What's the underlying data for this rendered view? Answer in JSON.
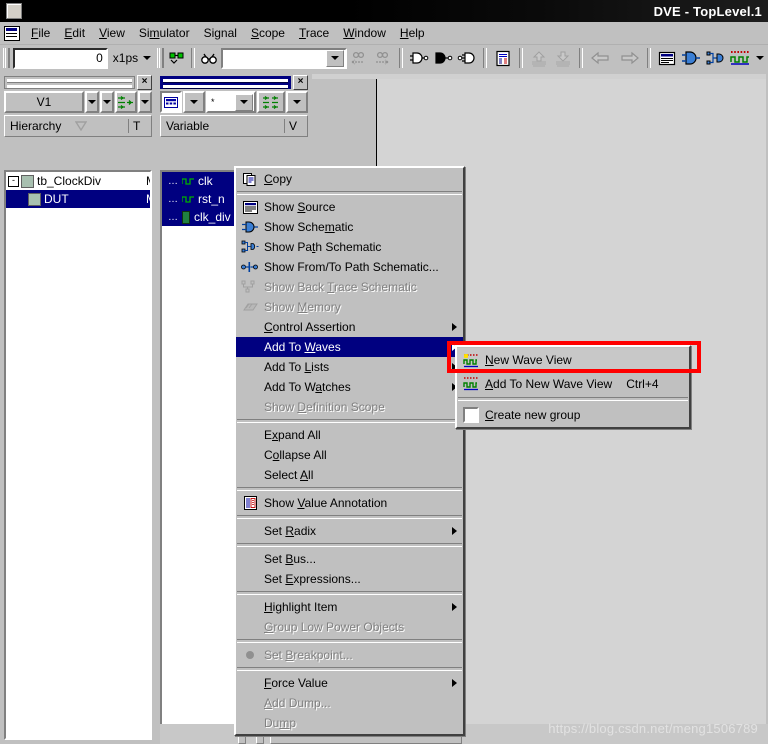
{
  "window": {
    "title": "DVE - TopLevel.1",
    "icon": "window-icon"
  },
  "menubar": {
    "icon": "document-menu-icon",
    "items": [
      {
        "label": "File",
        "mnemonic": "F"
      },
      {
        "label": "Edit",
        "mnemonic": "E"
      },
      {
        "label": "View",
        "mnemonic": "V"
      },
      {
        "label": "Simulator",
        "mnemonic": "m"
      },
      {
        "label": "Signal",
        "mnemonic": "S"
      },
      {
        "label": "Scope",
        "mnemonic": "S"
      },
      {
        "label": "Trace",
        "mnemonic": "T"
      },
      {
        "label": "Window",
        "mnemonic": "W"
      },
      {
        "label": "Help",
        "mnemonic": "H"
      }
    ]
  },
  "toolbar": {
    "time_value": "0",
    "time_unit": "x1ps",
    "goto_icon": "goto-signal-icon",
    "find_icon": "binoculars-find-icon",
    "search_value": "",
    "search_placeholder": "",
    "buttons": [
      {
        "name": "find-prev-icon"
      },
      {
        "name": "find-next-icon"
      },
      {
        "name": "show-driver-icon"
      },
      {
        "name": "show-load-icon"
      },
      {
        "name": "show-fanout-icon"
      },
      {
        "name": "show-source-icon"
      },
      {
        "name": "raise-icon"
      },
      {
        "name": "lower-icon"
      },
      {
        "name": "back-icon"
      },
      {
        "name": "forward-icon"
      },
      {
        "name": "source-view-icon"
      },
      {
        "name": "schematic-view-icon"
      },
      {
        "name": "path-schematic-icon"
      },
      {
        "name": "wave-view-icon"
      },
      {
        "name": "wave-dropdown-icon"
      }
    ]
  },
  "hierarchy_panel": {
    "title_active": false,
    "close_label": "×",
    "scope_combo": "V1",
    "column_headers": [
      "Hierarchy",
      "T"
    ],
    "sort_icon": "sort-descending-icon",
    "rows": [
      {
        "label": "tb_ClockDiv",
        "type": "M",
        "indent": 0,
        "selected": false,
        "expander": "-"
      },
      {
        "label": "DUT",
        "type": "M",
        "indent": 1,
        "selected": true,
        "expander": ""
      }
    ]
  },
  "variable_panel": {
    "title_active": true,
    "close_label": "×",
    "filter_value": "*",
    "column_headers": [
      "Variable",
      "V"
    ],
    "rows": [
      {
        "label": "clk",
        "icon": "wave-signal-icon",
        "selected": true
      },
      {
        "label": "rst_n",
        "icon": "wave-signal-icon",
        "selected": true
      },
      {
        "label": "clk_div",
        "icon": "bus-signal-icon",
        "selected": true
      }
    ]
  },
  "context_menu": {
    "groups": [
      [
        {
          "label": "Copy",
          "mnemonic": "C",
          "icon": "copy-icon",
          "enabled": true,
          "submenu": false,
          "highlighted": false,
          "accel": ""
        }
      ],
      [
        {
          "label": "Show Source",
          "mnemonic": "S",
          "icon": "source-icon",
          "enabled": true,
          "submenu": false,
          "highlighted": false,
          "accel": ""
        },
        {
          "label": "Show Schematic",
          "mnemonic": "m",
          "icon": "schematic-icon",
          "enabled": true,
          "submenu": false,
          "highlighted": false,
          "accel": ""
        },
        {
          "label": "Show Path Schematic",
          "mnemonic": "t",
          "icon": "path-schematic-icon",
          "enabled": true,
          "submenu": false,
          "highlighted": false,
          "accel": ""
        },
        {
          "label": "Show From/To Path Schematic...",
          "mnemonic": "",
          "icon": "from-to-path-icon",
          "enabled": true,
          "submenu": false,
          "highlighted": false,
          "accel": ""
        },
        {
          "label": "Show Back Trace Schematic",
          "mnemonic": "T",
          "icon": "back-trace-icon",
          "enabled": false,
          "submenu": false,
          "highlighted": false,
          "accel": ""
        },
        {
          "label": "Show Memory",
          "mnemonic": "M",
          "icon": "memory-icon",
          "enabled": false,
          "submenu": false,
          "highlighted": false,
          "accel": ""
        },
        {
          "label": "Control Assertion",
          "mnemonic": "C",
          "icon": "",
          "enabled": true,
          "submenu": true,
          "highlighted": false,
          "accel": ""
        },
        {
          "label": "Add To Waves",
          "mnemonic": "W",
          "icon": "",
          "enabled": true,
          "submenu": true,
          "highlighted": true,
          "accel": ""
        },
        {
          "label": "Add To Lists",
          "mnemonic": "L",
          "icon": "",
          "enabled": true,
          "submenu": true,
          "highlighted": false,
          "accel": ""
        },
        {
          "label": "Add To Watches",
          "mnemonic": "a",
          "icon": "",
          "enabled": true,
          "submenu": true,
          "highlighted": false,
          "accel": ""
        },
        {
          "label": "Show Definition Scope",
          "mnemonic": "D",
          "icon": "",
          "enabled": false,
          "submenu": false,
          "highlighted": false,
          "accel": ""
        }
      ],
      [
        {
          "label": "Expand All",
          "mnemonic": "x",
          "icon": "",
          "enabled": true,
          "submenu": false,
          "highlighted": false,
          "accel": ""
        },
        {
          "label": "Collapse All",
          "mnemonic": "o",
          "icon": "",
          "enabled": true,
          "submenu": false,
          "highlighted": false,
          "accel": ""
        },
        {
          "label": "Select All",
          "mnemonic": "A",
          "icon": "",
          "enabled": true,
          "submenu": false,
          "highlighted": false,
          "accel": ""
        }
      ],
      [
        {
          "label": "Show Value Annotation",
          "mnemonic": "V",
          "icon": "annotation-icon",
          "enabled": true,
          "submenu": false,
          "highlighted": false,
          "accel": ""
        }
      ],
      [
        {
          "label": "Set Radix",
          "mnemonic": "R",
          "icon": "",
          "enabled": true,
          "submenu": true,
          "highlighted": false,
          "accel": ""
        }
      ],
      [
        {
          "label": "Set Bus...",
          "mnemonic": "B",
          "icon": "",
          "enabled": true,
          "submenu": false,
          "highlighted": false,
          "accel": ""
        },
        {
          "label": "Set Expressions...",
          "mnemonic": "E",
          "icon": "",
          "enabled": true,
          "submenu": false,
          "highlighted": false,
          "accel": ""
        }
      ],
      [
        {
          "label": "Highlight Item",
          "mnemonic": "H",
          "icon": "",
          "enabled": true,
          "submenu": true,
          "highlighted": false,
          "accel": ""
        },
        {
          "label": "Group Low Power Objects",
          "mnemonic": "G",
          "icon": "",
          "enabled": false,
          "submenu": false,
          "highlighted": false,
          "accel": ""
        }
      ],
      [
        {
          "label": "Set Breakpoint...",
          "mnemonic": "B",
          "icon": "breakpoint-icon",
          "enabled": false,
          "submenu": false,
          "highlighted": false,
          "accel": ""
        }
      ],
      [
        {
          "label": "Force Value",
          "mnemonic": "F",
          "icon": "",
          "enabled": true,
          "submenu": true,
          "highlighted": false,
          "accel": ""
        },
        {
          "label": "Add Dump...",
          "mnemonic": "A",
          "icon": "",
          "enabled": false,
          "submenu": false,
          "highlighted": false,
          "accel": ""
        },
        {
          "label": "Dump",
          "mnemonic": "m",
          "icon": "",
          "enabled": false,
          "submenu": false,
          "highlighted": false,
          "accel": ""
        }
      ]
    ]
  },
  "submenu": {
    "items": [
      {
        "label": "New Wave View",
        "mnemonic": "N",
        "icon": "new-wave-view-icon",
        "accel": "",
        "hovered": true,
        "enabled": true,
        "separator_after": false
      },
      {
        "label": "Add To New Wave View",
        "mnemonic": "A",
        "icon": "wave-view-icon",
        "accel": "Ctrl+4",
        "hovered": false,
        "enabled": true,
        "separator_after": true
      },
      {
        "label": "Create new group",
        "mnemonic": "C",
        "icon": "checkbox-icon",
        "accel": "",
        "hovered": false,
        "enabled": true,
        "separator_after": false
      }
    ]
  },
  "annotation": {
    "highlight_color": "#ff0000",
    "highlight_target": "New Wave View"
  },
  "watermark": {
    "text": "https://blog.csdn.net/meng1506789"
  },
  "colors": {
    "face": "#c0c0c0",
    "selection": "#000080",
    "titlebar": "#000000",
    "highlight_red": "#ff0000"
  }
}
